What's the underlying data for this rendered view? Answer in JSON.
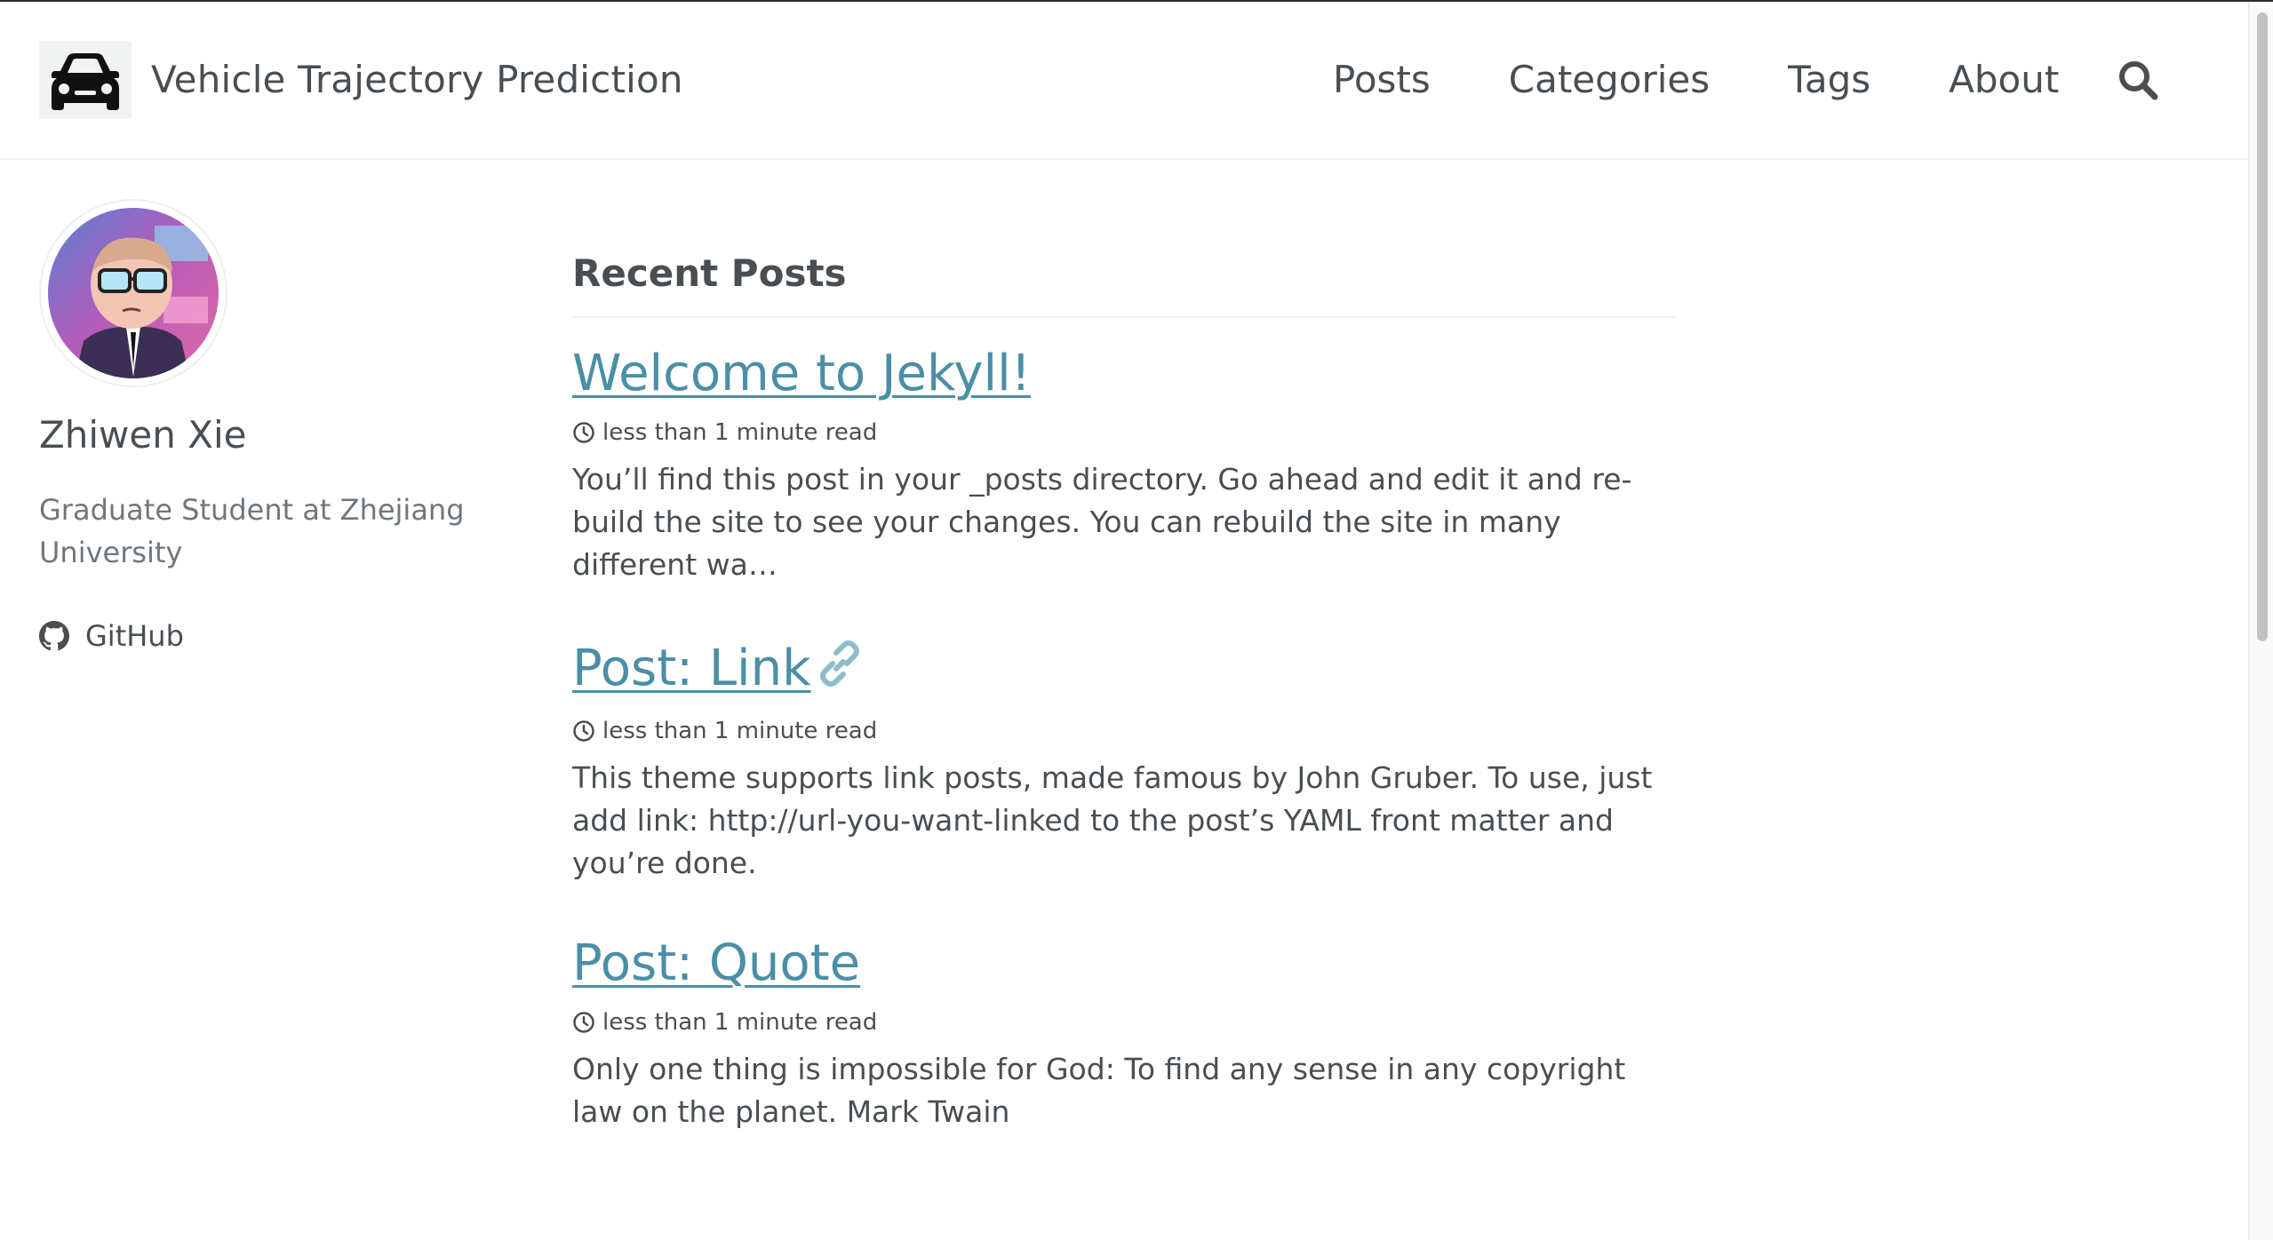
{
  "masthead": {
    "site_title": "Vehicle Trajectory Prediction",
    "logo_icon": "car-icon",
    "nav": [
      {
        "label": "Posts"
      },
      {
        "label": "Categories"
      },
      {
        "label": "Tags"
      },
      {
        "label": "About"
      }
    ],
    "search_icon": "search-icon"
  },
  "sidebar": {
    "author_name": "Zhiwen Xie",
    "bio": "Graduate Student at Zhejiang University",
    "links": [
      {
        "label": "GitHub",
        "icon": "github-icon"
      }
    ]
  },
  "main": {
    "section_title": "Recent Posts",
    "posts": [
      {
        "title": "Welcome to Jekyll!",
        "read_time": "less than 1 minute read",
        "excerpt": "You’ll find this post in your _posts directory. Go ahead and edit it and re-build the site to see your changes. You can rebuild the site in many different wa…"
      },
      {
        "title": "Post: Link",
        "read_time": "less than 1 minute read",
        "excerpt": "This theme supports link posts, made famous by John Gruber. To use, just add link: http://url-you-want-linked to the post’s YAML front matter and you’re done."
      },
      {
        "title": "Post: Quote",
        "read_time": "less than 1 minute read",
        "excerpt": "Only one thing is impossible for God: To find any sense in any copyright law on the planet. Mark Twain"
      }
    ]
  },
  "colors": {
    "text": "#494e52",
    "link": "#4a8fa6",
    "muted": "#6f777d",
    "border": "#f2f3f3"
  }
}
